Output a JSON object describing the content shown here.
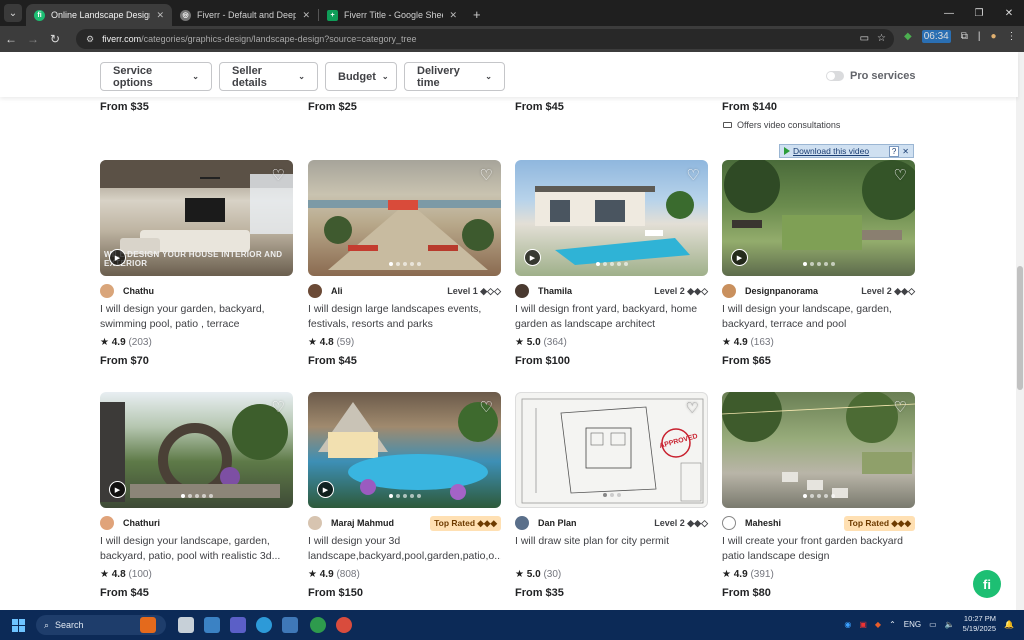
{
  "browser": {
    "tabs": [
      {
        "title": "Online Landscape Design Servic",
        "fav_color": "#1dbf73",
        "fav_letter": "fi",
        "active": true
      },
      {
        "title": "Fiverr - Default and Deep Links",
        "fav_color": "#888888",
        "fav_letter": "◎",
        "active": false
      },
      {
        "title": "Fiverr Title - Google Sheets",
        "fav_color": "#0f9d58",
        "fav_letter": "+",
        "active": false
      }
    ],
    "url_host": "fiverr.com",
    "url_path": "/categories/graphics-design/landscape-design?source=category_tree",
    "ext_badge": "06:34"
  },
  "filters": {
    "service_options": "Service options",
    "seller_details": "Seller details",
    "budget": "Budget",
    "delivery_time": "Delivery time",
    "pro_services": "Pro services"
  },
  "top_row": {
    "prices": [
      "From $35",
      "From $25",
      "From $45",
      "From $140"
    ],
    "video_consult": "Offers video consultations"
  },
  "download_bar": {
    "label": "Download this video",
    "help": "?"
  },
  "gigs": [
    {
      "seller": "Chathu",
      "level": "",
      "title": "I will design your garden, backyard, swimming pool, patio , terrace",
      "rating": "4.9",
      "reviews": "(203)",
      "price": "From $70",
      "thumb_overlay": "WILL DESIGN YOUR HOUSE INTERIOR AND EXTERIOR"
    },
    {
      "seller": "Ali",
      "level": "Level 1 ◆◇◇",
      "title": "I will design large landscapes events, festivals, resorts and parks",
      "rating": "4.8",
      "reviews": "(59)",
      "price": "From $45",
      "thumb_overlay": ""
    },
    {
      "seller": "Thamila",
      "level": "Level 2 ◆◆◇",
      "title": "I will design front yard, backyard, home garden as landscape architect",
      "rating": "5.0",
      "reviews": "(364)",
      "price": "From $100",
      "thumb_overlay": ""
    },
    {
      "seller": "Designpanorama",
      "level": "Level 2 ◆◆◇",
      "title": "I will design your landscape, garden, backyard, terrace and pool",
      "rating": "4.9",
      "reviews": "(163)",
      "price": "From $65",
      "thumb_overlay": ""
    },
    {
      "seller": "Chathuri",
      "level": "",
      "title": "I will design your landscape, garden, backyard, patio, pool with realistic 3d...",
      "rating": "4.8",
      "reviews": "(100)",
      "price": "From $45",
      "thumb_overlay": ""
    },
    {
      "seller": "Maraj Mahmud",
      "level": "Top Rated ◆◆◆",
      "title": "I will design your 3d landscape,backyard,pool,garden,patio,o...",
      "rating": "4.9",
      "reviews": "(808)",
      "price": "From $150",
      "thumb_overlay": ""
    },
    {
      "seller": "Dan Plan",
      "level": "Level 2 ◆◆◇",
      "title": "I will draw site plan for city permit",
      "rating": "5.0",
      "reviews": "(30)",
      "price": "From $35",
      "thumb_overlay": "APPROVED"
    },
    {
      "seller": "Maheshi",
      "level": "Top Rated ◆◆◆",
      "title": "I will create your front garden backyard patio landscape design",
      "rating": "4.9",
      "reviews": "(391)",
      "price": "From $80",
      "thumb_overlay": ""
    }
  ],
  "fab_label": "fi",
  "taskbar": {
    "search": "Search",
    "lang": "ENG",
    "time": "10:27 PM",
    "date": "5/19/2025"
  }
}
